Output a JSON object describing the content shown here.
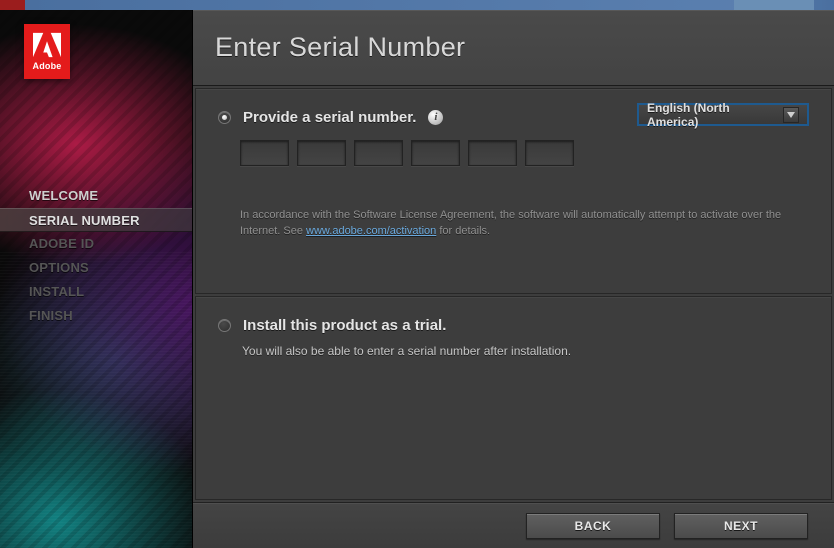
{
  "brand": {
    "name": "Adobe"
  },
  "nav": {
    "items": [
      {
        "label": "WELCOME",
        "state": "done"
      },
      {
        "label": "SERIAL NUMBER",
        "state": "active"
      },
      {
        "label": "ADOBE ID",
        "state": "upcoming"
      },
      {
        "label": "OPTIONS",
        "state": "upcoming"
      },
      {
        "label": "INSTALL",
        "state": "upcoming"
      },
      {
        "label": "FINISH",
        "state": "upcoming"
      }
    ]
  },
  "title": "Enter Serial Number",
  "serialOption": {
    "label": "Provide a serial number.",
    "selected": true,
    "info_icon": "i"
  },
  "language": {
    "selected": "English (North America)"
  },
  "license": {
    "pre": "In accordance with the Software License Agreement, the software will automatically attempt to activate over the Internet. See ",
    "link_text": "www.adobe.com/activation",
    "post": " for details."
  },
  "trialOption": {
    "label": "Install this product as a trial.",
    "selected": false,
    "sub": "You will also be able to enter a serial number after installation."
  },
  "buttons": {
    "back": "BACK",
    "next": "NEXT"
  }
}
